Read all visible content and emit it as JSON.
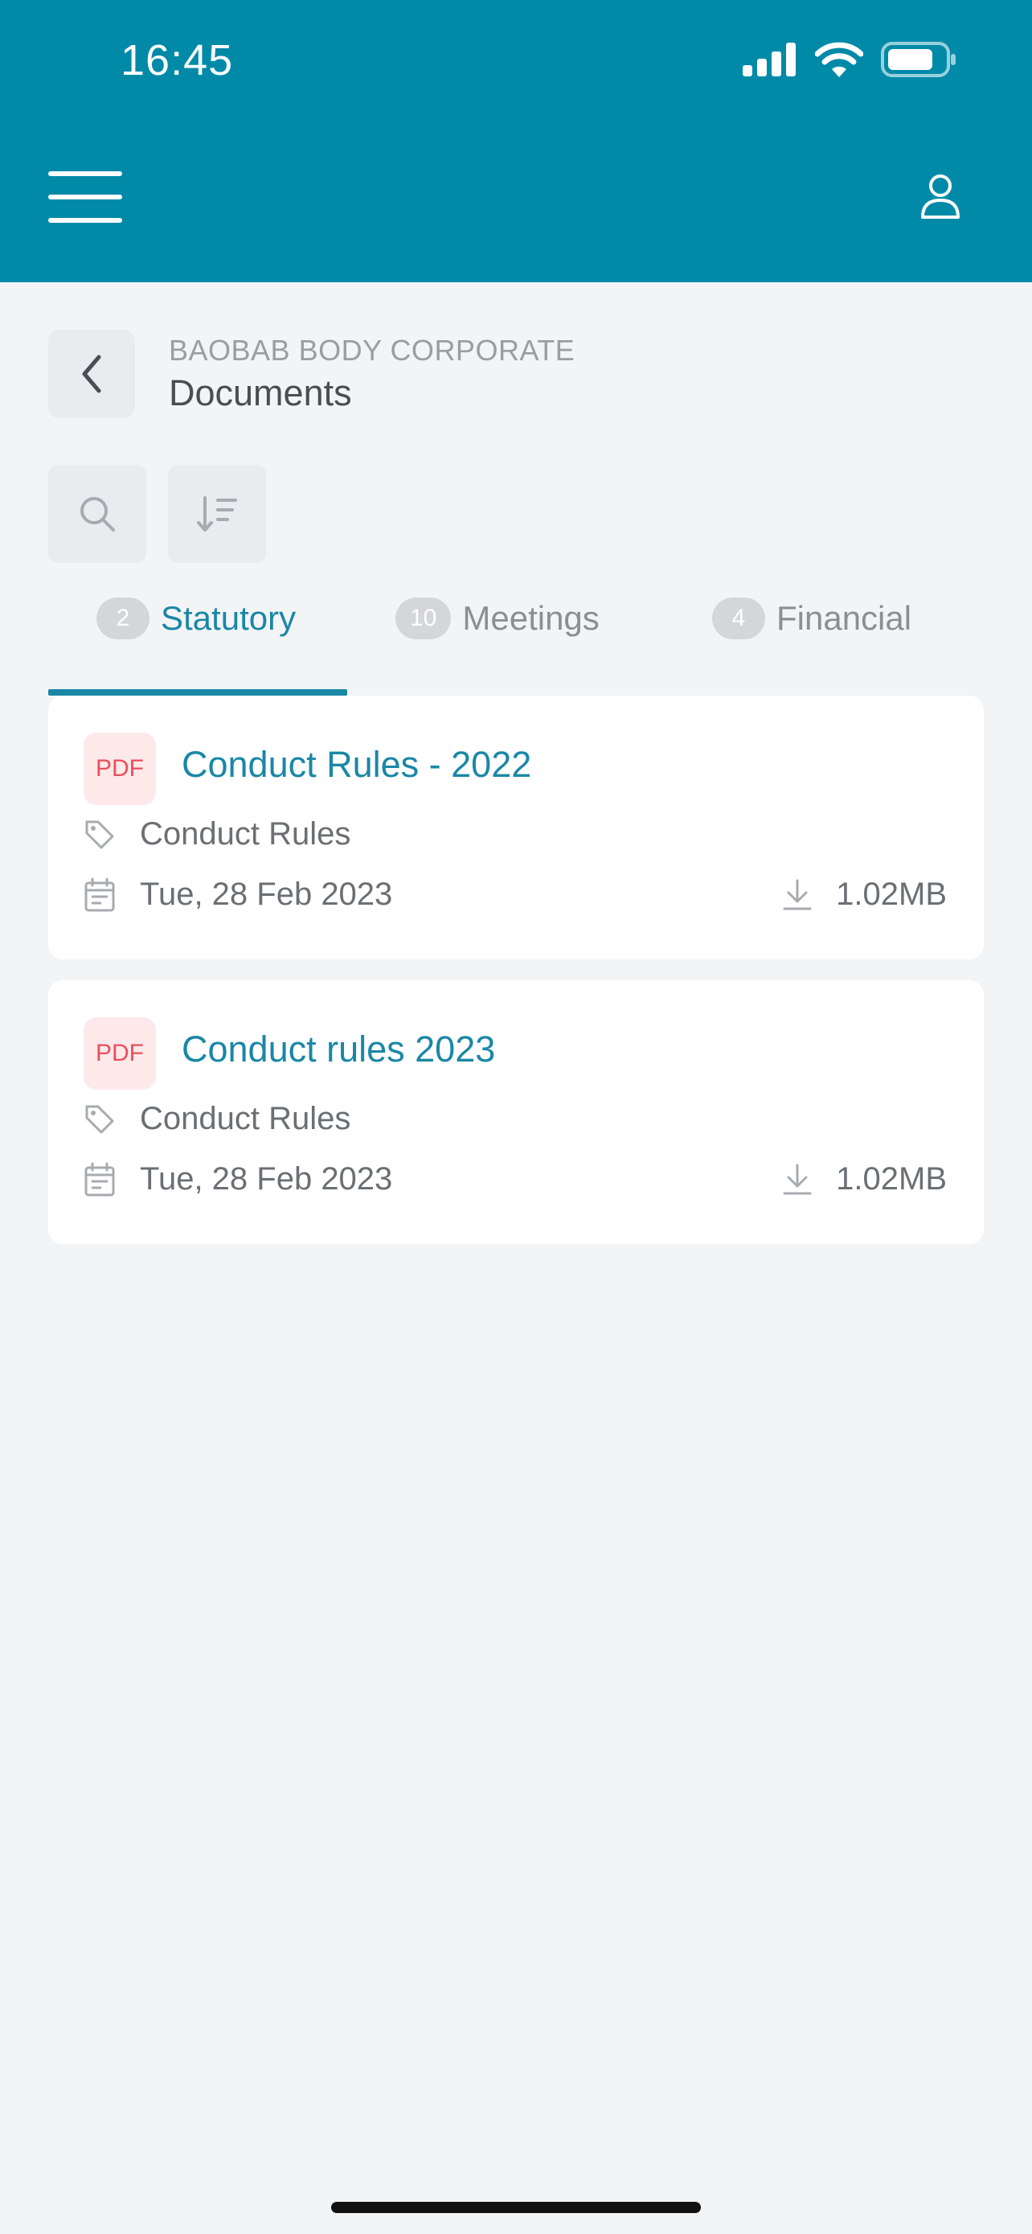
{
  "status_bar": {
    "time": "16:45"
  },
  "header": {
    "menu_icon": "hamburger-menu-icon",
    "profile_icon": "user-profile-icon",
    "background": "#008aa8"
  },
  "breadcrumb": {
    "organization": "BAOBAB BODY CORPORATE",
    "title": "Documents"
  },
  "toolbar": {
    "search_icon": "search-icon",
    "sort_icon": "sort-descending-icon"
  },
  "tabs": [
    {
      "count": "2",
      "label": "Statutory",
      "active": true
    },
    {
      "count": "10",
      "label": "Meetings",
      "active": false
    },
    {
      "count": "4",
      "label": "Financial",
      "active": false
    }
  ],
  "documents": [
    {
      "type_badge": "PDF",
      "title": "Conduct Rules - 2022",
      "category": "Conduct Rules",
      "date": "Tue, 28 Feb 2023",
      "size": "1.02MB"
    },
    {
      "type_badge": "PDF",
      "title": "Conduct rules 2023",
      "category": "Conduct Rules",
      "date": "Tue, 28 Feb 2023",
      "size": "1.02MB"
    }
  ],
  "colors": {
    "accent": "#1a87a6",
    "pdf_badge_text": "#e8505b",
    "pdf_badge_bg": "#fde8ea"
  }
}
